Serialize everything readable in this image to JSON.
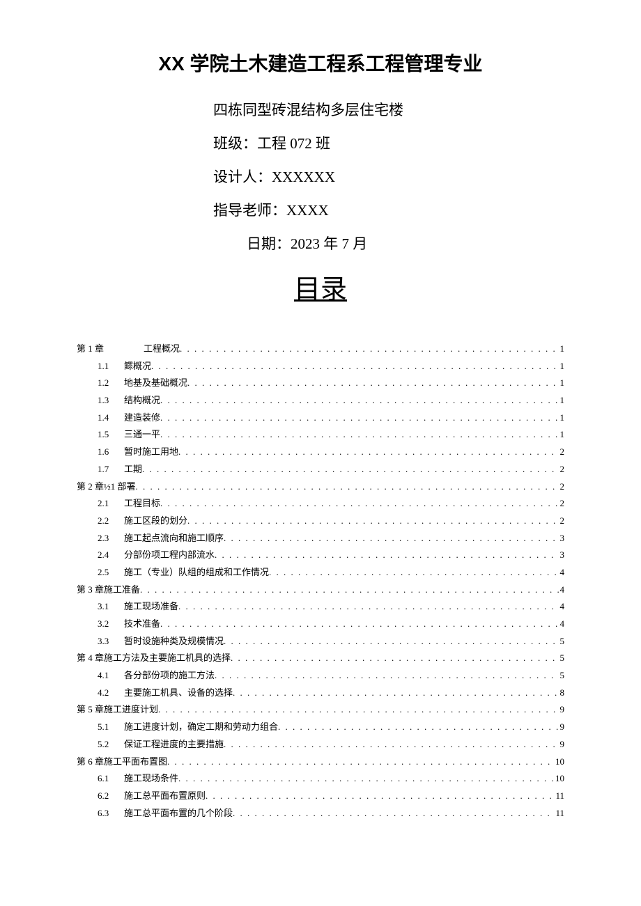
{
  "header": {
    "main_title": "XX 学院土木建造工程系工程管理专业",
    "subtitle1": "四栋同型砖混结构多层住宅楼",
    "class_line": "班级：工程 072 班",
    "designer_line": "设计人：XXXXXX",
    "teacher_line": "指导老师：XXXX",
    "date_line": "日期：2023 年 7 月"
  },
  "toc_title": "目录",
  "toc": [
    {
      "level": 1,
      "num": "第 1 章",
      "label": "工程概况",
      "page": "1",
      "numwide": true
    },
    {
      "level": 2,
      "num": "1.1",
      "label": "鳏概况",
      "page": "1"
    },
    {
      "level": 2,
      "num": "1.2",
      "label": "地基及基础概况",
      "page": "1"
    },
    {
      "level": 2,
      "num": "1.3",
      "label": "结构概况",
      "page": "1"
    },
    {
      "level": 2,
      "num": "1.4",
      "label": "建造装修",
      "page": "1"
    },
    {
      "level": 2,
      "num": "1.5",
      "label": "三通一平",
      "page": "1"
    },
    {
      "level": 2,
      "num": "1.6",
      "label": "暂时施工用地",
      "page": "2"
    },
    {
      "level": 2,
      "num": "1.7",
      "label": "工期",
      "page": "2"
    },
    {
      "level": 1,
      "num": "第 2 章½1 部署",
      "label": "",
      "page": "2"
    },
    {
      "level": 2,
      "num": "2.1",
      "label": "工程目标",
      "page": "2"
    },
    {
      "level": 2,
      "num": "2.2",
      "label": "施工区段的划分",
      "page": "2"
    },
    {
      "level": 2,
      "num": "2.3",
      "label": "施工起点流向和施工顺序",
      "page": "3"
    },
    {
      "level": 2,
      "num": "2.4",
      "label": "分部份项工程内部流水",
      "page": "3"
    },
    {
      "level": 2,
      "num": "2.5",
      "label": "施工（专业）队组的组成和工作情况",
      "page": "4"
    },
    {
      "level": 1,
      "num": "第 3 章施工准备",
      "label": "",
      "page": "4"
    },
    {
      "level": 2,
      "num": "3.1",
      "label": "施工现场准备",
      "page": "4"
    },
    {
      "level": 2,
      "num": "3.2",
      "label": "技术准备",
      "page": "4"
    },
    {
      "level": 2,
      "num": "3.3",
      "label": "暂时设施种类及规模情况",
      "page": "5"
    },
    {
      "level": 1,
      "num": "第 4 章施工方法及主要施工机具的选择",
      "label": "",
      "page": "5"
    },
    {
      "level": 2,
      "num": "4.1",
      "label": "各分部份项的施工方法",
      "page": "5"
    },
    {
      "level": 2,
      "num": "4.2",
      "label": "主要施工机具、设备的选择",
      "page": "8"
    },
    {
      "level": 1,
      "num": "第 5 章施工进度计划",
      "label": "",
      "page": "9"
    },
    {
      "level": 2,
      "num": "5.1",
      "label": "施工进度计划，确定工期和劳动力组合",
      "page": "9"
    },
    {
      "level": 2,
      "num": "5.2",
      "label": "保证工程进度的主要措施",
      "page": "9"
    },
    {
      "level": 1,
      "num": "第 6 章施工平面布置图",
      "label": "",
      "page": "10"
    },
    {
      "level": 2,
      "num": "6.1",
      "label": "施工现场条件",
      "page": "10"
    },
    {
      "level": 2,
      "num": "6.2",
      "label": "施工总平面布置原则",
      "page": "11"
    },
    {
      "level": 2,
      "num": "6.3",
      "label": "施工总平面布置的几个阶段",
      "page": "11"
    }
  ]
}
